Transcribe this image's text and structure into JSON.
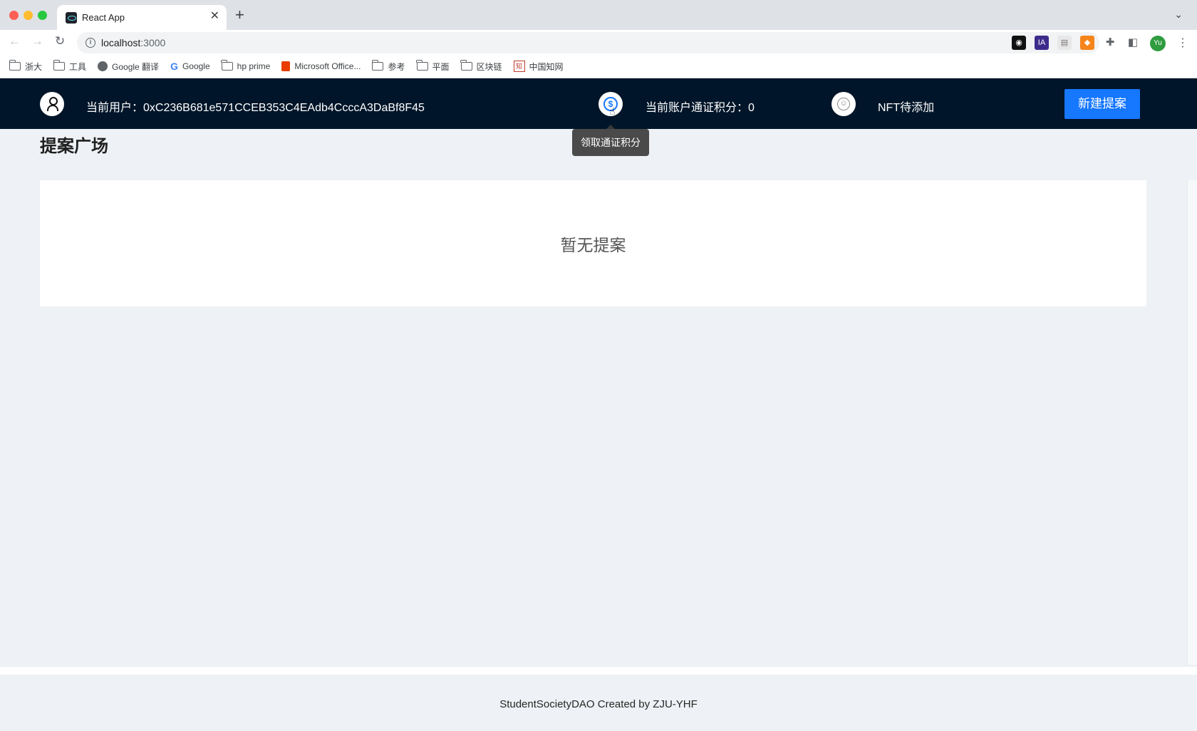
{
  "browser": {
    "tab_title": "React App",
    "tab_close": "✕",
    "new_tab": "+",
    "url_host": "localhost",
    "url_port": ":3000",
    "profile_initials": "Yu",
    "bookmarks": [
      "浙大",
      "工具",
      "Google 翻译",
      "Google",
      "hp prime",
      "Microsoft Office...",
      "参考",
      "平面",
      "区块链",
      "中国知网"
    ]
  },
  "header": {
    "user_label": "当前用户：",
    "user_address": "0xC236B681e571CCEB353C4EAdb4CcccA3DaBf8F45",
    "points_label": "当前账户通证积分：",
    "points_value": "0",
    "nft_label": "NFT待添加",
    "new_proposal_button": "新建提案"
  },
  "tooltip": {
    "text": "领取通证积分"
  },
  "main": {
    "title": "提案广场",
    "empty_text": "暂无提案"
  },
  "footer": {
    "text": "StudentSocietyDAO Created by ZJU-YHF"
  },
  "colors": {
    "header_bg": "#001529",
    "primary": "#1677ff",
    "content_bg": "#eef1f5"
  }
}
